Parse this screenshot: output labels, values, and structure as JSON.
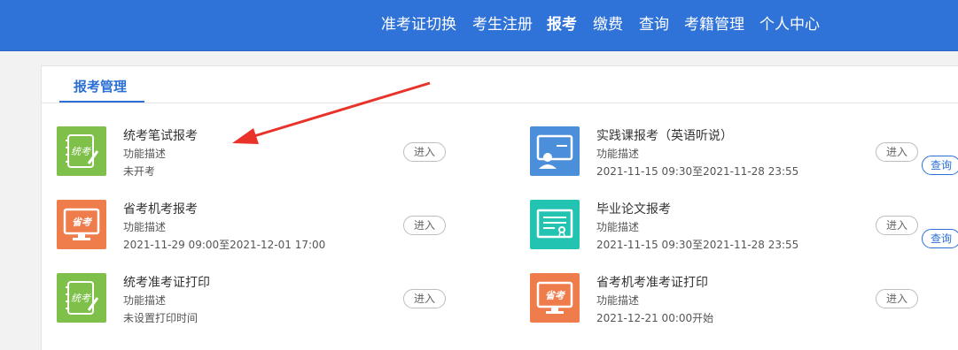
{
  "nav": {
    "items": [
      {
        "label": "准考证切换"
      },
      {
        "label": "考生注册"
      },
      {
        "label": "报考",
        "active": true
      },
      {
        "label": "缴费"
      },
      {
        "label": "查询"
      },
      {
        "label": "考籍管理"
      },
      {
        "label": "个人中心"
      }
    ]
  },
  "tab": {
    "label": "报考管理"
  },
  "cards": [
    {
      "title": "统考笔试报考",
      "desc": "功能描述",
      "status": "未开考",
      "enter": "进入",
      "icon": "notebook-pen-icon"
    },
    {
      "title": "实践课报考（英语听说）",
      "desc": "功能描述",
      "status": "2021-11-15 09:30至2021-11-28 23:55",
      "enter": "进入",
      "query": "查询",
      "icon": "teacher-board-icon"
    },
    {
      "title": "省考机考报考",
      "desc": "功能描述",
      "status": "2021-11-29 09:00至2021-12-01 17:00",
      "enter": "进入",
      "icon": "computer-exam-icon"
    },
    {
      "title": "毕业论文报考",
      "desc": "功能描述",
      "status": "2021-11-15 09:30至2021-11-28 23:55",
      "enter": "进入",
      "query": "查询",
      "icon": "certificate-icon"
    },
    {
      "title": "统考准考证打印",
      "desc": "功能描述",
      "status": "未设置打印时间",
      "enter": "进入",
      "icon": "notebook-pen-icon"
    },
    {
      "title": "省考机考准考证打印",
      "desc": "功能描述",
      "status": "2021-12-21 00:00开始",
      "enter": "进入",
      "icon": "computer-exam-icon"
    }
  ],
  "icon_glyphs": {
    "notebook": "统考",
    "computer": "省考"
  },
  "colors": {
    "header": "#2f72d8",
    "accent": "#2b6fd6",
    "green": "#7ec04a",
    "orange": "#ef7d4c",
    "blue": "#4b8fdb",
    "teal": "#22c3b0",
    "arrow": "#e8322a"
  }
}
